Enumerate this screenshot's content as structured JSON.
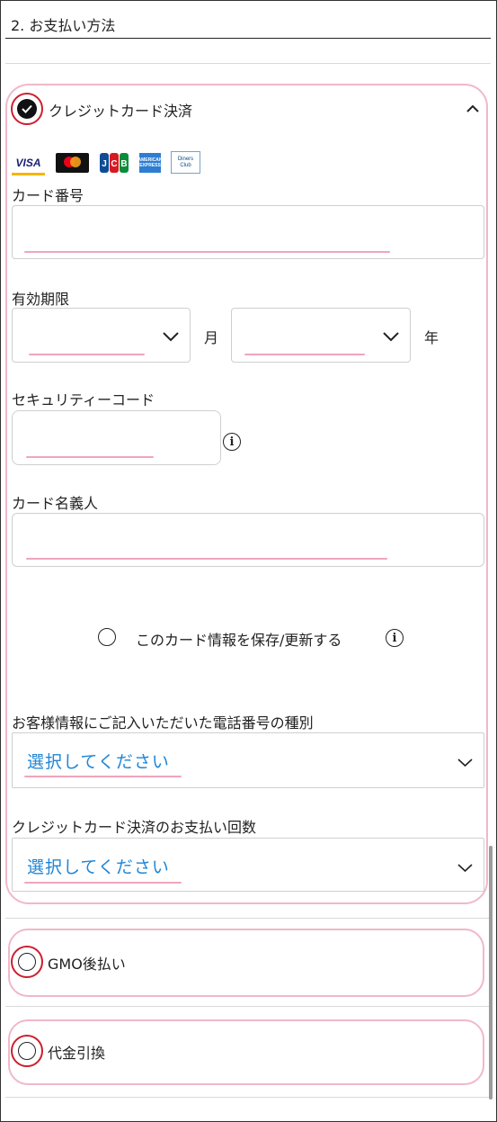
{
  "section": {
    "title": "2. お支払い方法"
  },
  "credit": {
    "label": "クレジットカード決済",
    "brands": [
      "VISA",
      "mastercard",
      "JCB",
      "AMERICAN EXPRESS",
      "Diners Club"
    ],
    "card_number_label": "カード番号",
    "expiry_label": "有効期限",
    "month_unit": "月",
    "year_unit": "年",
    "security_label": "セキュリティーコード",
    "holder_label": "カード名義人",
    "save_label": "このカード情報を保存/更新する",
    "phone_type_label": "お客様情報にご記入いただいた電話番号の種別",
    "phone_type_value": "選択してください",
    "installments_label": "クレジットカード決済のお支払い回数",
    "installments_value": "選択してください"
  },
  "options": {
    "gmo_label": "GMO後払い",
    "cod_label": "代金引換"
  },
  "colors": {
    "accent_pink": "#f0b8c8",
    "marker_red": "#cc1f2e",
    "link_blue": "#1f86d6"
  }
}
